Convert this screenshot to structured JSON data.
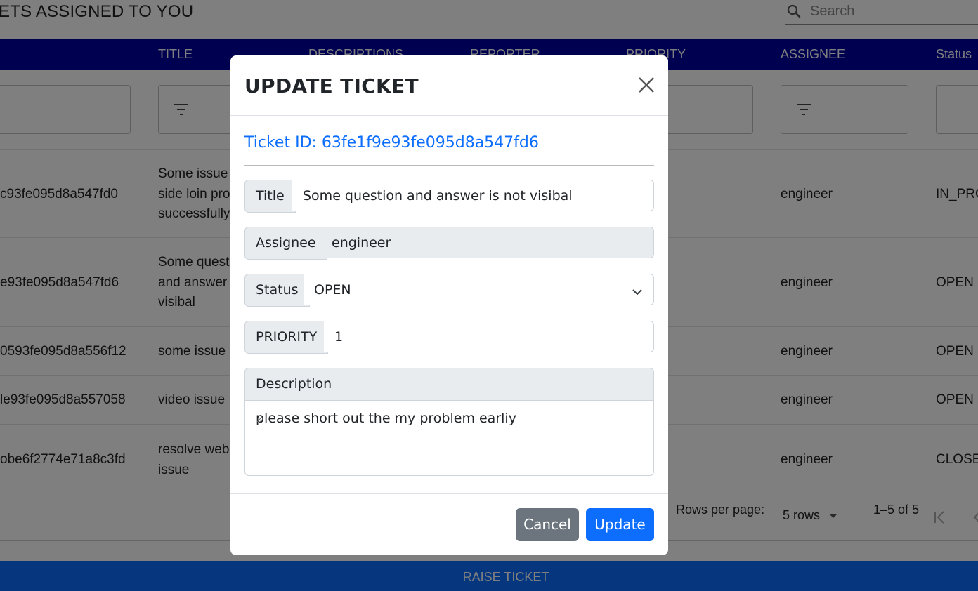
{
  "page": {
    "title": "ETS ASSIGNED TO YOU",
    "search_placeholder": "Search"
  },
  "table": {
    "columns": [
      "TITLE",
      "DESCRIPTIONS",
      "REPORTER",
      "PRIORITY",
      "ASSIGNEE",
      "Status"
    ],
    "rows": [
      {
        "id": "c93fe095d8a547fd0",
        "title": "Some issue side loin pro successfully",
        "assignee": "engineer",
        "status": "IN_PRO"
      },
      {
        "id": "e93fe095d8a547fd6",
        "title": "Some quest and answer visibal",
        "assignee": "engineer",
        "status": "OPEN"
      },
      {
        "id": "0593fe095d8a556f12",
        "title": "some issue",
        "assignee": "engineer",
        "status": "OPEN"
      },
      {
        "id": "le93fe095d8a557058",
        "title": "video issue",
        "assignee": "engineer",
        "status": "OPEN"
      },
      {
        "id": "obe6f2774e71a8c3fd",
        "title": "resolve web issue",
        "assignee": "engineer",
        "status": "CLOSEI"
      }
    ]
  },
  "pagination": {
    "rows_per_page_label": "Rows per page:",
    "rows_value": "5 rows",
    "range": "1–5 of 5"
  },
  "raise_button": "RAISE TICKET",
  "modal": {
    "title": "UPDATE TICKET",
    "ticket_id": "Ticket ID: 63fe1f9e93fe095d8a547fd6",
    "fields": {
      "title_label": "Title",
      "title_value": "Some question and answer is not visibal",
      "assignee_label": "Assignee",
      "assignee_value": "engineer",
      "status_label": "Status",
      "status_value": "OPEN",
      "priority_label": "PRIORITY",
      "priority_value": "1",
      "description_label": "Description",
      "description_value": "please short out the my problem earliy"
    },
    "buttons": {
      "cancel": "Cancel",
      "update": "Update"
    }
  },
  "colors": {
    "header_bg": "#0000a0",
    "primary": "#0d6efd",
    "secondary": "#6c757d"
  }
}
